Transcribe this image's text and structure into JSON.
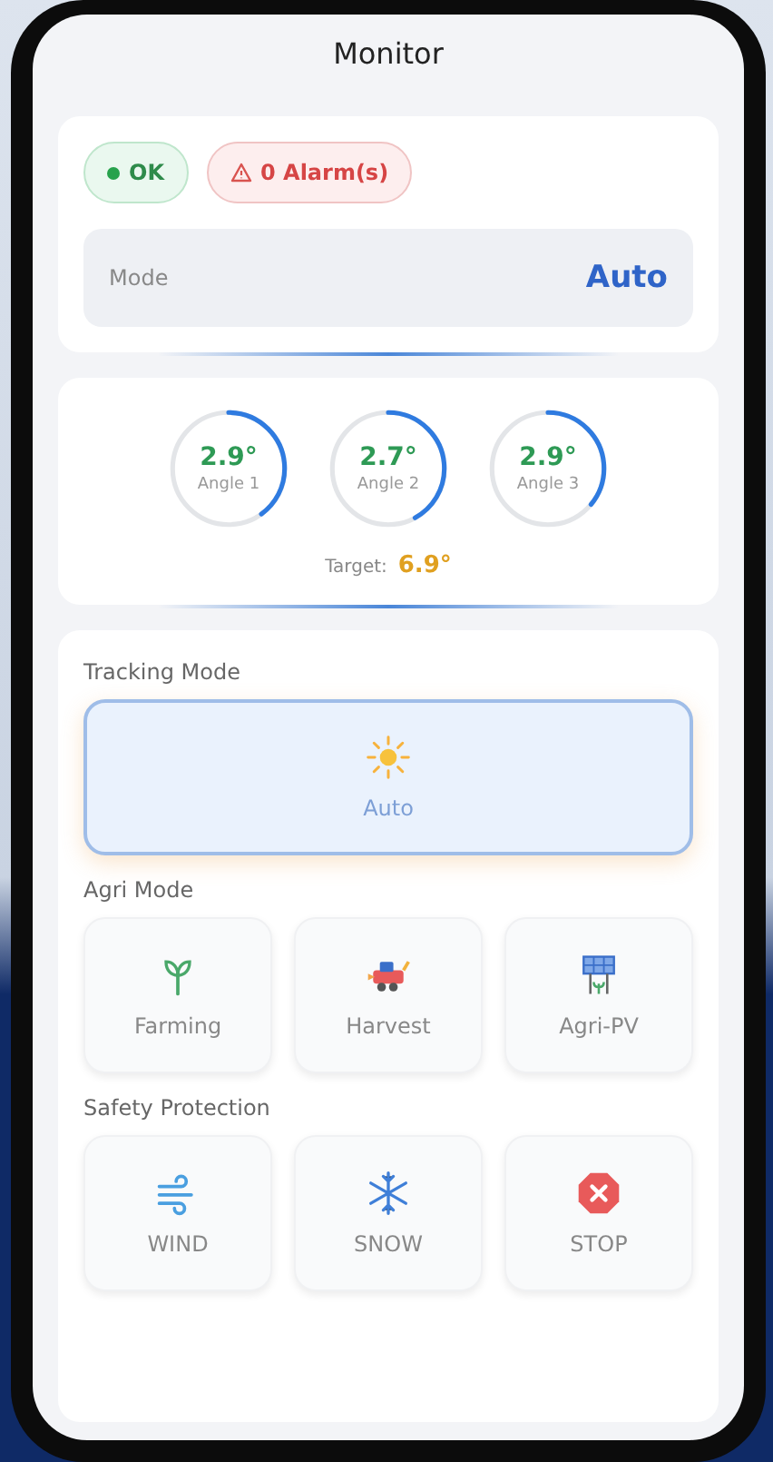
{
  "title": "Monitor",
  "status": {
    "ok_label": "OK",
    "alarm_label": "0 Alarm(s)"
  },
  "mode": {
    "label": "Mode",
    "value": "Auto"
  },
  "angles": [
    {
      "value": "2.9°",
      "label": "Angle 1",
      "level": 0.4
    },
    {
      "value": "2.7°",
      "label": "Angle 2",
      "level": 0.42
    },
    {
      "value": "2.9°",
      "label": "Angle 3",
      "level": 0.36
    }
  ],
  "target": {
    "label": "Target:",
    "value": "6.9°"
  },
  "sections": [
    {
      "title": "Tracking Mode",
      "items": [
        {
          "kind": "sun",
          "label": "Auto",
          "selected": true
        }
      ]
    },
    {
      "title": "Agri Mode",
      "items": [
        {
          "kind": "sprout",
          "label": "Farming",
          "selected": false
        },
        {
          "kind": "tractor",
          "label": "Harvest",
          "selected": false
        },
        {
          "kind": "solar",
          "label": "Agri-PV",
          "selected": false
        }
      ]
    },
    {
      "title": "Safety Protection",
      "items": [
        {
          "kind": "wind",
          "label": "WIND",
          "selected": false
        },
        {
          "kind": "snow",
          "label": "SNOW",
          "selected": false
        },
        {
          "kind": "stop",
          "label": "STOP",
          "selected": false
        }
      ]
    }
  ]
}
